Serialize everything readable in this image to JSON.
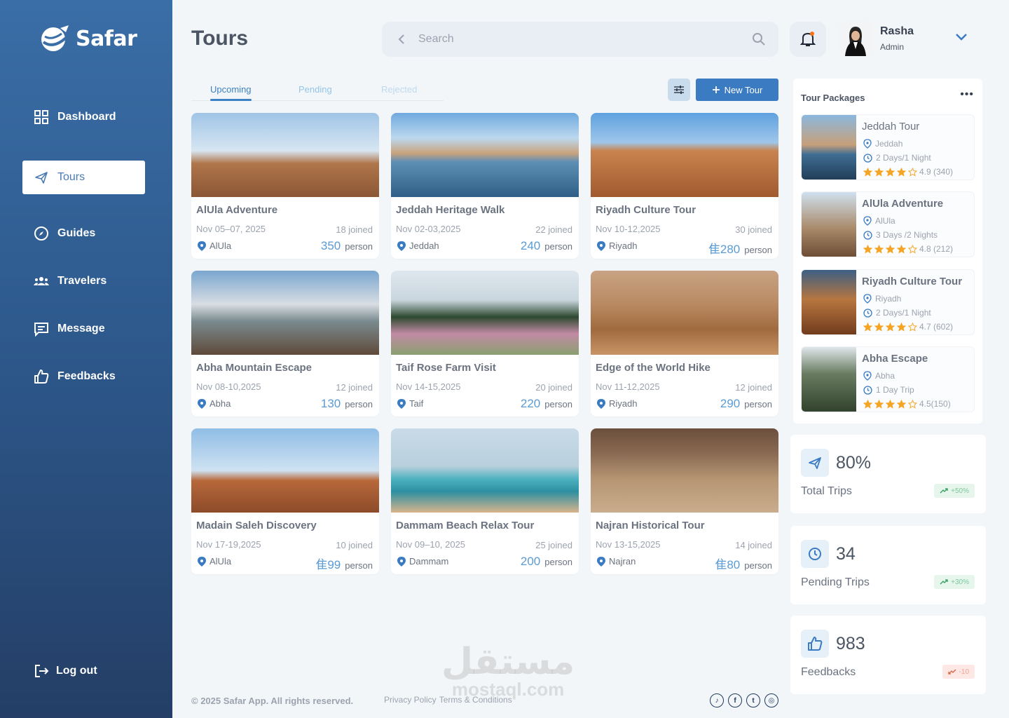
{
  "app": {
    "name": "Safar"
  },
  "sidebar": {
    "items": [
      {
        "label": "Dashboard",
        "icon": "grid-icon"
      },
      {
        "label": "Tours",
        "icon": "plane-icon",
        "active": true
      },
      {
        "label": "Guides",
        "icon": "compass-icon"
      },
      {
        "label": "Travelers",
        "icon": "users-icon"
      },
      {
        "label": "Message",
        "icon": "message-icon"
      },
      {
        "label": "Feedbacks",
        "icon": "thumbs-up-icon"
      }
    ],
    "logout": "Log out"
  },
  "header": {
    "title": "Tours",
    "search_placeholder": "Search",
    "user": {
      "name": "Rasha",
      "role": "Admin"
    }
  },
  "tabs": [
    "Upcoming",
    "Pending",
    "Rejected"
  ],
  "toolbar": {
    "new_tour": "New Tour"
  },
  "tours": [
    {
      "name": "AlUla Adventure",
      "date": "Nov 05–07, 2025",
      "joined": "18 joined",
      "location": "AlUla",
      "price": "350",
      "unit": "person"
    },
    {
      "name": "Jeddah Heritage Walk",
      "date": "Nov 02-03,2025",
      "joined": "22 joined",
      "location": "Jeddah",
      "price": "240",
      "unit": "person"
    },
    {
      "name": "Riyadh Culture Tour",
      "date": "Nov 10-12,2025",
      "joined": "30 joined",
      "location": "Riyadh",
      "price": "⾫280",
      "unit": "person"
    },
    {
      "name": "Abha Mountain Escape",
      "date": "Nov 08-10,2025",
      "joined": "12 joined",
      "location": "Abha",
      "price": "130",
      "unit": "person"
    },
    {
      "name": "Taif Rose Farm Visit",
      "date": "Nov 14-15,2025",
      "joined": "20 joined",
      "location": "Taif",
      "price": "220",
      "unit": "person"
    },
    {
      "name": "Edge of the World Hike",
      "date": "Nov 11-12,2025",
      "joined": "12 joined",
      "location": "Riyadh",
      "price": "290",
      "unit": "person"
    },
    {
      "name": "Madain Saleh Discovery",
      "date": "Nov 17-19,2025",
      "joined": "10 joined",
      "location": "AlUla",
      "price": "⾫99",
      "unit": "person"
    },
    {
      "name": "Dammam Beach Relax Tour",
      "date": "Nov 09–10, 2025",
      "joined": "25 joined",
      "location": "Dammam",
      "price": "200",
      "unit": "person"
    },
    {
      "name": "Najran Historical Tour",
      "date": "Nov 13-15,2025",
      "joined": "14 joined",
      "location": "Najran",
      "price": "⾫80",
      "unit": "person"
    }
  ],
  "packages": {
    "title": "Tour Packages",
    "items": [
      {
        "name": "Jeddah Tour",
        "location": "Jeddah",
        "duration": "2 Days/1 Night",
        "rating": "4.9 (340)"
      },
      {
        "name": "AlUla Adventure",
        "location": "AlUla",
        "duration": "3 Days /2 Nights",
        "rating": "4.8 (212)"
      },
      {
        "name": "Riyadh Culture Tour",
        "location": "Riyadh",
        "duration": "2 Days/1 Night",
        "rating": "4.7 (602)"
      },
      {
        "name": "Abha Escape",
        "location": "Abha",
        "duration": "1 Day Trip",
        "rating": "4.5(150)"
      }
    ]
  },
  "stats": [
    {
      "value": "80%",
      "label": "Total Trips",
      "trend": "+50%",
      "direction": "up",
      "icon": "plane-icon"
    },
    {
      "value": "34",
      "label": "Pending Trips",
      "trend": "+30%",
      "direction": "up",
      "icon": "clock-icon"
    },
    {
      "value": "983",
      "label": "Feedbacks",
      "trend": "-10",
      "direction": "down",
      "icon": "thumbs-up-icon"
    }
  ],
  "footer": {
    "copyright": "© 2025 Safar App. All rights reserved.",
    "privacy": "Privacy Policy",
    "terms": "Terms & Conditions",
    "social": [
      "tiktok-icon",
      "facebook-icon",
      "twitter-icon",
      "instagram-icon"
    ]
  },
  "watermark": {
    "arabic": "مستقل",
    "latin": "mostaql.com"
  },
  "colors": {
    "primary": "#3a7bc2",
    "sidebar_top": "#3a6ea6",
    "sidebar_bottom": "#243e66",
    "price": "#5a9bd4",
    "star": "#f5a524"
  }
}
